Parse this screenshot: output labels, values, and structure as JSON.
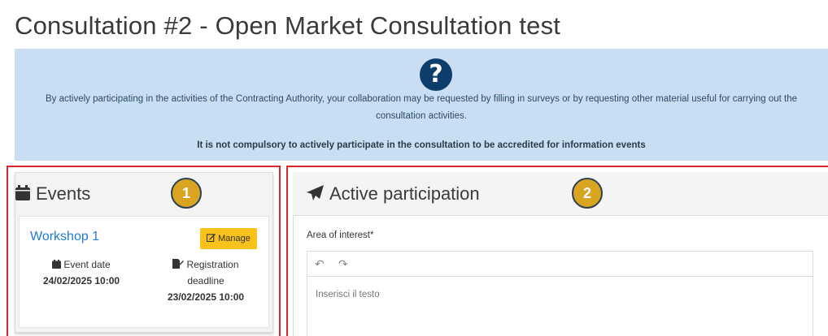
{
  "page": {
    "title": "Consultation #2 - Open Market Consultation test"
  },
  "info": {
    "icon": "question-circle-icon",
    "text": "By actively participating in the activities of the Contracting Authority, your collaboration may be requested by filling in surveys or by requesting other material useful for carrying out the consultation activities.",
    "bold_text": "It is not compulsory to actively participate in the consultation to be accredited for information events"
  },
  "events": {
    "title": "Events",
    "badge": "1",
    "items": [
      {
        "name": "Workshop 1",
        "manage_label": "Manage",
        "event_date_label": "Event date",
        "event_date": "24/02/2025 10:00",
        "deadline_label": "Registration deadline",
        "deadline": "23/02/2025 10:00"
      }
    ]
  },
  "participation": {
    "title": "Active participation",
    "badge": "2",
    "field_label": "Area of interest*",
    "placeholder": "Inserisci il testo"
  },
  "colors": {
    "info_bg": "#c9def2",
    "highlight": "#d9272e",
    "badge": "#d9a521",
    "manage_button": "#f8c21b",
    "link": "#1f7ad6"
  }
}
